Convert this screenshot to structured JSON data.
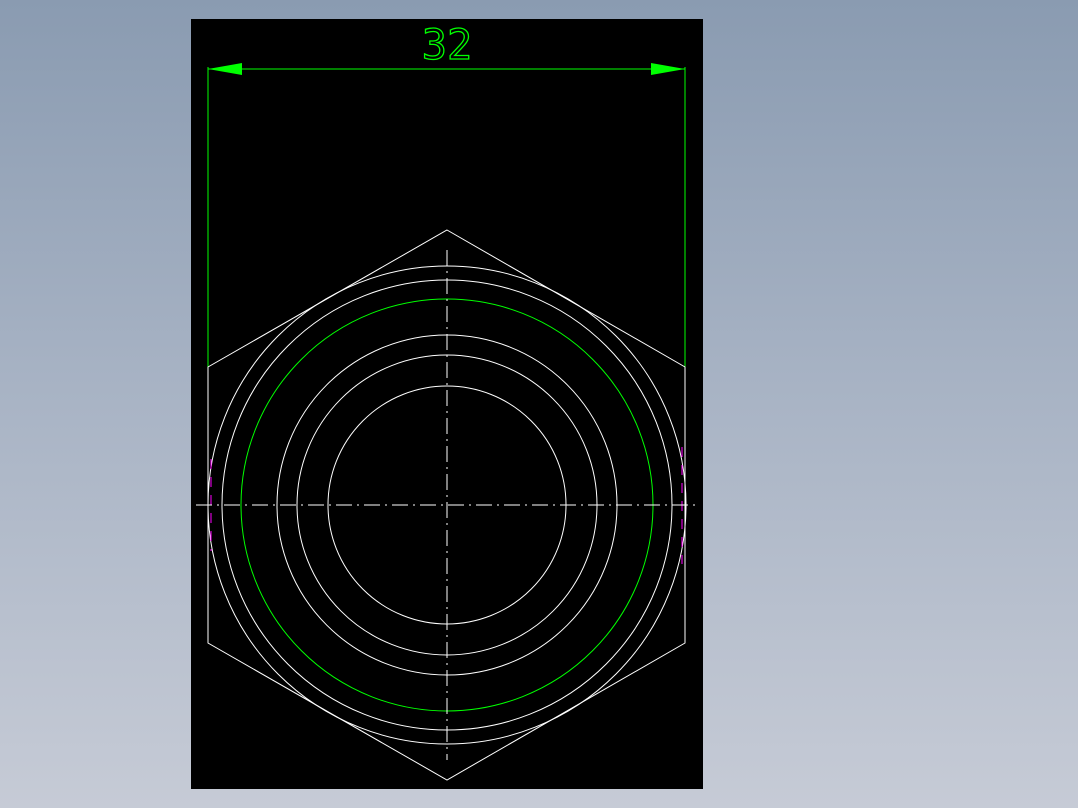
{
  "drawing": {
    "dimension_text": "32",
    "background_color": "#000000",
    "geometry_color": "#ffffff",
    "dimension_color": "#00ff00",
    "hidden_line_color": "#ff00ff",
    "centerline_color": "#ffffff"
  }
}
